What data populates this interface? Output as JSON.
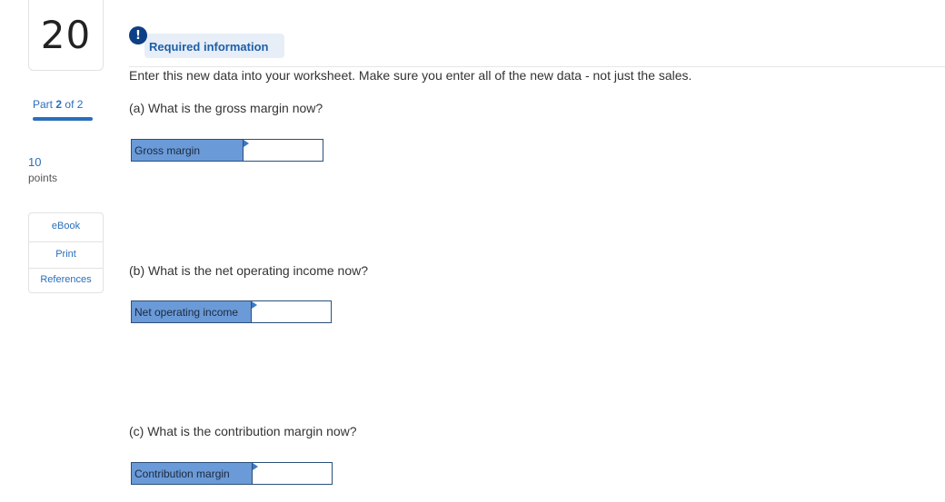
{
  "question": {
    "number": "20"
  },
  "part": {
    "prefix": "Part",
    "current": "2",
    "separator": "of",
    "total": "2",
    "progress": 1.0
  },
  "points": {
    "value": "10",
    "label": "points"
  },
  "tools": [
    {
      "label": "eBook"
    },
    {
      "label": "Print"
    },
    {
      "label": "References"
    }
  ],
  "alert": {
    "icon": "!",
    "text": "Required information"
  },
  "instruction": "Enter this new data into your worksheet. Make sure you enter all of the new data - not just the sales.",
  "questions": [
    {
      "prompt": "(a) What is the gross margin now?",
      "field_label": "Gross margin",
      "value": ""
    },
    {
      "prompt": "(b) What is the net operating income now?",
      "field_label": "Net operating income",
      "value": ""
    },
    {
      "prompt": "(c) What is the contribution margin now?",
      "field_label": "Contribution margin",
      "value": ""
    }
  ],
  "colors": {
    "accent": "#2a6ebb",
    "label_fill": "#6b9ad8",
    "alert_icon": "#0c3f85",
    "alert_bg": "#e7eef7"
  }
}
